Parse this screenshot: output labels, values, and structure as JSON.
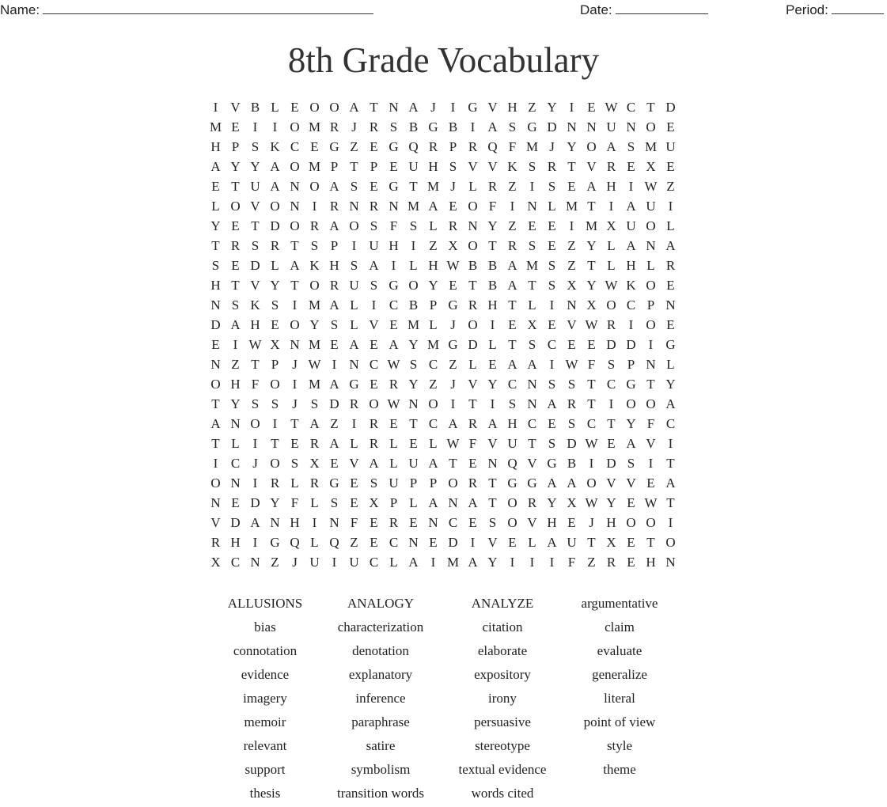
{
  "header": {
    "name_label": "Name:",
    "date_label": "Date:",
    "period_label": "Period:"
  },
  "title": "8th Grade Vocabulary",
  "grid": [
    "IVBLEOOATNAJIGVHZYIEWCTD",
    "MEIIOMRJRSBGBIASGDNNUNOE",
    "HPSKCEGZEGQRPRQFMJYOASMU",
    "AYYAOMPTPEUHSVVKSRTVREXE",
    "ETUANOASEGTMJLRZISEAHIWZ",
    "LOVONIRNRNMAEOFINLMTIAUI",
    "YETDORAOSFSLRNYZEEIMXUOL",
    "TRSRTSPIUHIZXOTRSEZYLANA",
    "SEDLAKHSAILHWBBAMSZTLHLR",
    "HTVYTORUSGOYETBATSXYWKOE",
    "NSKSIMALICBPGRHTLINXOCPN",
    "DAHEOYSLVEMLJOIEXEVWRIOE",
    "EIWXNMEAEAYMGDLTSCEEDDIG",
    "NZTPJWINCWSCZLEAAIWFSPNL",
    "OHFOIMAGERYZJVYCNSSTCGTY",
    "TYSSJSDROWNOITISNARTIOOA",
    "ANOITAZIRETCARAHCESCTYFC",
    "TLITERALRLELWFVUTSDWEAVI",
    "ICJOSXEVALUATENQVGBIDSIT",
    "ONIRLRGESUPPORTGGAAOVVEA",
    "NEDYFLSEXPLANATORYXWYEWT",
    "VDANHINFERENCESOVHEJHOOI",
    "RHIGQLQZECNEDIVELAUTXETO",
    "XCNZJUIUCLAIMAYIIIFZREHN"
  ],
  "word_list": [
    "ALLUSIONS",
    "ANALOGY",
    "ANALYZE",
    "argumentative",
    "bias",
    "characterization",
    "citation",
    "claim",
    "connotation",
    "denotation",
    "elaborate",
    "evaluate",
    "evidence",
    "explanatory",
    "expository",
    "generalize",
    "imagery",
    "inference",
    "irony",
    "literal",
    "memoir",
    "paraphrase",
    "persuasive",
    "point of view",
    "relevant",
    "satire",
    "stereotype",
    "style",
    "support",
    "symbolism",
    "textual evidence",
    "theme",
    "thesis",
    "transition words",
    "words cited"
  ]
}
